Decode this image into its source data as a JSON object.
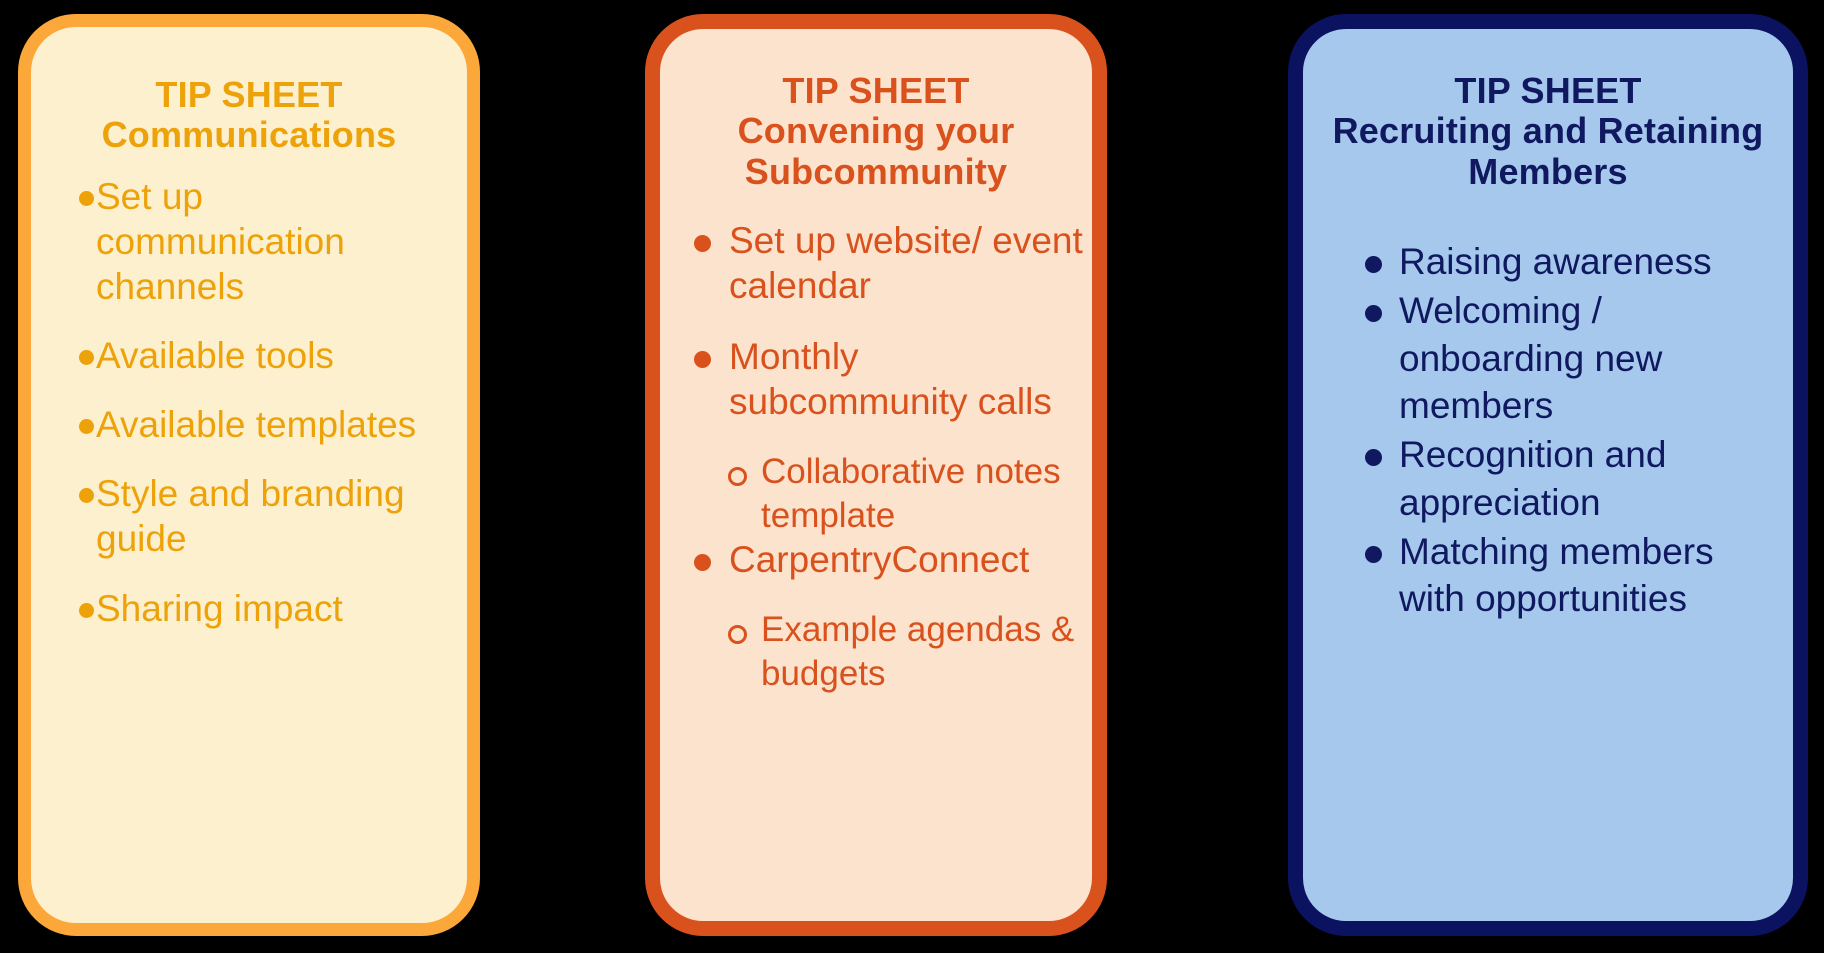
{
  "colors": {
    "page_background": "#000000",
    "communications_border": "#FBA73A",
    "communications_fill": "#FDF0CE",
    "communications_text": "#EDA20A",
    "convening_border": "#D9511C",
    "convening_fill": "#FBE3CD",
    "convening_text": "#D9511C",
    "recruiting_border": "#0B1260",
    "recruiting_fill": "#A5C8EC",
    "recruiting_text": "#101860"
  },
  "cards": [
    {
      "eyebrow": "TIP SHEET",
      "title": "Communications",
      "bullets": [
        {
          "text": "Set up communication channels",
          "sub": []
        },
        {
          "text": "Available tools",
          "sub": []
        },
        {
          "text": "Available templates",
          "sub": []
        },
        {
          "text": "Style and branding guide",
          "sub": []
        },
        {
          "text": "Sharing impact",
          "sub": []
        }
      ]
    },
    {
      "eyebrow": "TIP SHEET",
      "title": "Convening your Subcommunity",
      "bullets": [
        {
          "text": "Set up website/ event calendar",
          "sub": []
        },
        {
          "text": "Monthly subcommunity calls",
          "sub": [
            "Collaborative notes template"
          ]
        },
        {
          "text": "CarpentryConnect",
          "sub": [
            "Example agendas & budgets"
          ]
        }
      ]
    },
    {
      "eyebrow": "TIP SHEET",
      "title": "Recruiting and Retaining Members",
      "bullets": [
        {
          "text": "Raising awareness",
          "sub": []
        },
        {
          "text": "Welcoming / onboarding new members",
          "sub": []
        },
        {
          "text": "Recognition and appreciation",
          "sub": []
        },
        {
          "text": "Matching members with opportunities",
          "sub": []
        }
      ]
    }
  ]
}
